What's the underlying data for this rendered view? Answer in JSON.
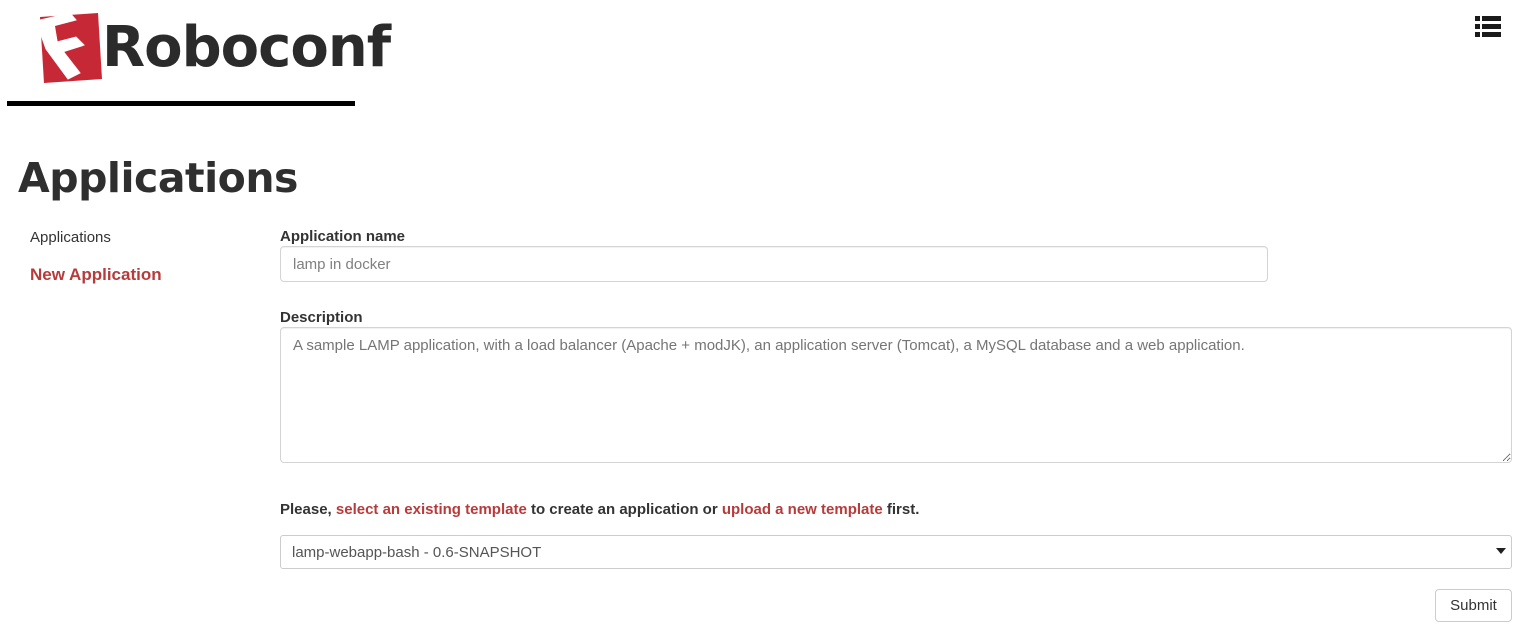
{
  "header": {
    "brand_name": "Roboconf",
    "brand_letter": "R",
    "menu_icon": "list-icon"
  },
  "page": {
    "title": "Applications"
  },
  "sidebar": {
    "items": [
      {
        "label": "Applications",
        "active": false
      },
      {
        "label": "New Application",
        "active": true
      }
    ]
  },
  "form": {
    "name_label": "Application name",
    "name_placeholder": "lamp in docker",
    "name_value": "",
    "description_label": "Description",
    "description_placeholder": "A sample LAMP application, with a load balancer (Apache + modJK), an application server (Tomcat), a MySQL database and a web application.",
    "description_value": "",
    "hint_prefix": "Please, ",
    "hint_link_1": "select an existing template",
    "hint_middle": " to create an application or ",
    "hint_link_2": "upload a new template",
    "hint_suffix": " first.",
    "template_selected": "lamp-webapp-bash - 0.6-SNAPSHOT",
    "template_options": [
      "lamp-webapp-bash - 0.6-SNAPSHOT"
    ],
    "submit_label": "Submit"
  },
  "colors": {
    "brand_red": "#c62836",
    "link_red": "#b83b3b",
    "text_dark": "#333333",
    "border_grey": "#cccccc"
  }
}
